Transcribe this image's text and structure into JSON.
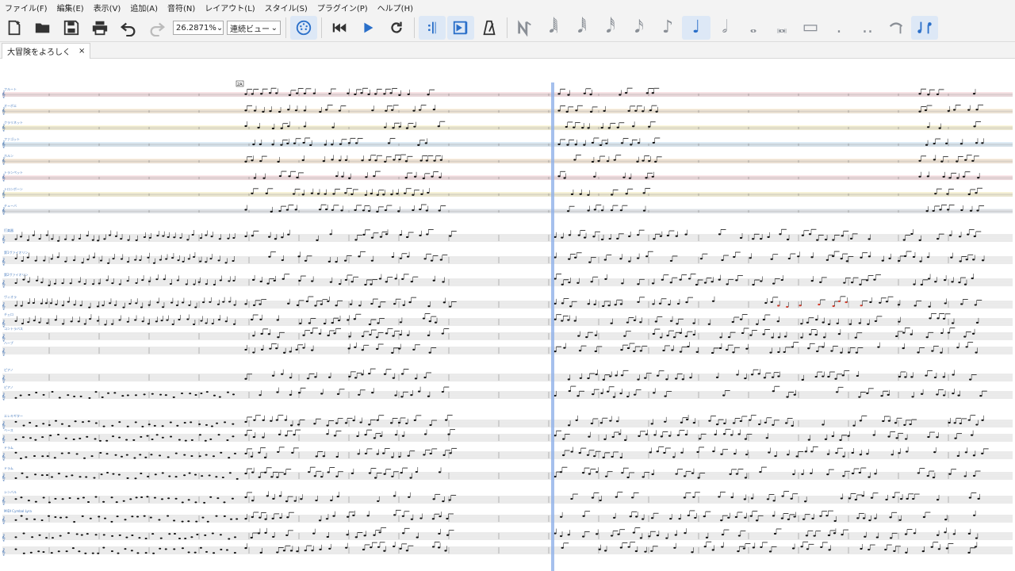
{
  "menu": [
    "ファイル(F)",
    "編集(E)",
    "表示(V)",
    "追加(A)",
    "音符(N)",
    "レイアウト(L)",
    "スタイル(S)",
    "プラグイン(P)",
    "ヘルプ(H)"
  ],
  "toolbar": {
    "zoom": "26.2871%",
    "view_mode": "連続ビュー",
    "icons": [
      "new-score-icon",
      "open-icon",
      "save-icon",
      "print-icon",
      "undo-icon",
      "redo-icon"
    ],
    "note_glyphs": [
      "𝅘𝅥𝅲",
      "𝅘𝅥𝅱",
      "𝅘𝅥𝅰",
      "𝅘𝅥𝅯",
      "♪",
      "♩",
      "𝅗𝅥",
      "𝅝",
      "𝅜",
      "▭",
      ".",
      ".."
    ]
  },
  "tab": {
    "title": "大冒険をよろしく",
    "close": "×"
  },
  "score": {
    "staff_names": [
      "フルート",
      "オーボエ",
      "クラリネット",
      "ファゴット",
      "ホルン",
      "トランペット",
      "トロンボーン",
      "チューバ",
      "打楽器",
      "第1ヴァイオリン",
      "第2ヴァイオリン",
      "ヴィオラ",
      "チェロ",
      "コントラバス",
      "ハープ",
      "ピアノ",
      "ピアノ",
      "エレキギター",
      "ベース",
      "ドラム",
      "ドラム",
      "シンバル",
      "MIDI Cymbal Lyra"
    ],
    "marker": "2A",
    "playhead_measure": 12,
    "colors": {
      "playhead": "#8fb0e8",
      "staff": "#9a9a9a",
      "notes": "#111111",
      "accent": "#d23a2a"
    }
  }
}
